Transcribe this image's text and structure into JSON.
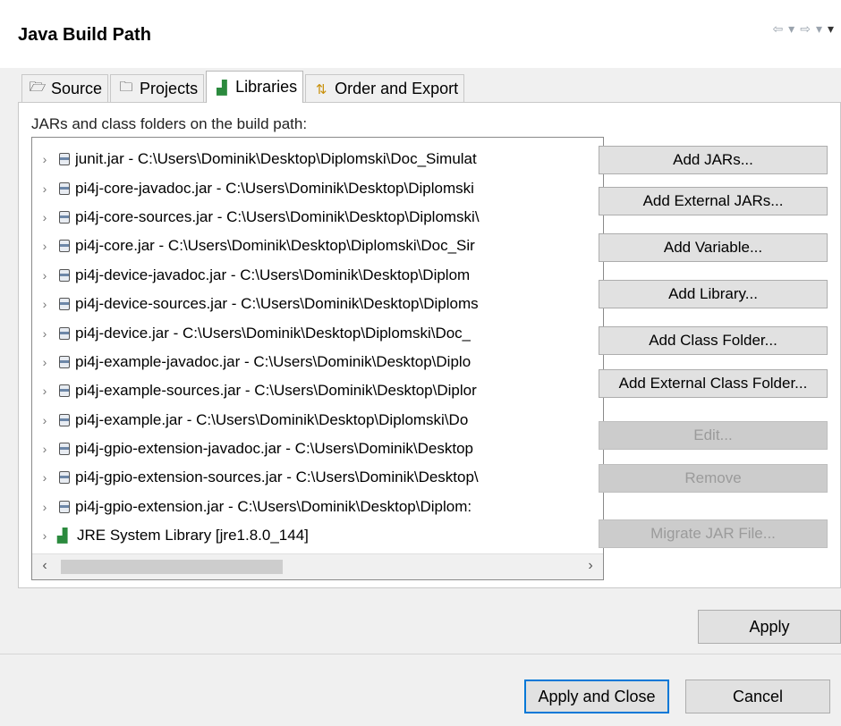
{
  "header": {
    "title": "Java Build Path"
  },
  "tabs": [
    {
      "label": "Source",
      "icon": "source-folder-icon",
      "selected": false
    },
    {
      "label": "Projects",
      "icon": "projects-folder-icon",
      "selected": false
    },
    {
      "label": "Libraries",
      "icon": "libraries-icon",
      "selected": true
    },
    {
      "label": "Order and Export",
      "icon": "order-export-icon",
      "selected": false
    }
  ],
  "panel": {
    "label": "JARs and class folders on the build path:"
  },
  "tree": {
    "items": [
      {
        "text": "junit.jar - C:\\Users\\Dominik\\Desktop\\Diplomski\\Doc_Simulat",
        "icon": "jar-icon"
      },
      {
        "text": "pi4j-core-javadoc.jar - C:\\Users\\Dominik\\Desktop\\Diplomski",
        "icon": "jar-icon"
      },
      {
        "text": "pi4j-core-sources.jar - C:\\Users\\Dominik\\Desktop\\Diplomski\\",
        "icon": "jar-icon"
      },
      {
        "text": "pi4j-core.jar - C:\\Users\\Dominik\\Desktop\\Diplomski\\Doc_Sir",
        "icon": "jar-icon"
      },
      {
        "text": "pi4j-device-javadoc.jar - C:\\Users\\Dominik\\Desktop\\Diplom",
        "icon": "jar-icon"
      },
      {
        "text": "pi4j-device-sources.jar - C:\\Users\\Dominik\\Desktop\\Diploms",
        "icon": "jar-icon"
      },
      {
        "text": "pi4j-device.jar - C:\\Users\\Dominik\\Desktop\\Diplomski\\Doc_",
        "icon": "jar-icon"
      },
      {
        "text": "pi4j-example-javadoc.jar - C:\\Users\\Dominik\\Desktop\\Diplo",
        "icon": "jar-icon"
      },
      {
        "text": "pi4j-example-sources.jar - C:\\Users\\Dominik\\Desktop\\Diplor",
        "icon": "jar-icon"
      },
      {
        "text": "pi4j-example.jar - C:\\Users\\Dominik\\Desktop\\Diplomski\\Do",
        "icon": "jar-icon"
      },
      {
        "text": "pi4j-gpio-extension-javadoc.jar - C:\\Users\\Dominik\\Desktop",
        "icon": "jar-icon"
      },
      {
        "text": "pi4j-gpio-extension-sources.jar - C:\\Users\\Dominik\\Desktop\\",
        "icon": "jar-icon"
      },
      {
        "text": "pi4j-gpio-extension.jar - C:\\Users\\Dominik\\Desktop\\Diplom:",
        "icon": "jar-icon"
      },
      {
        "text": "JRE System Library [jre1.8.0_144]",
        "icon": "library-icon"
      }
    ]
  },
  "buttons": {
    "add_jars": "Add JARs...",
    "add_external_jars": "Add External JARs...",
    "add_variable": "Add Variable...",
    "add_library": "Add Library...",
    "add_class_folder": "Add Class Folder...",
    "add_external_class_folder": "Add External Class Folder...",
    "edit": "Edit...",
    "remove": "Remove",
    "migrate_jar": "Migrate JAR File...",
    "apply": "Apply",
    "apply_and_close": "Apply and Close",
    "cancel": "Cancel"
  },
  "colors": {
    "accent": "#0078d7",
    "disabled_text": "#9b9b9b"
  }
}
